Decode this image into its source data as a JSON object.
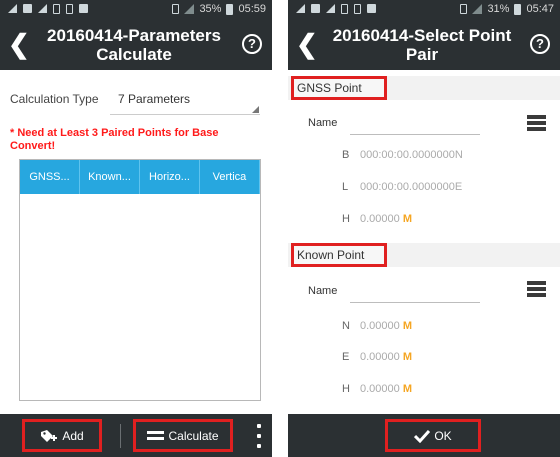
{
  "left": {
    "status": {
      "battery": "35%",
      "time": "05:59"
    },
    "title_line1": "20160414-Parameters",
    "title_line2": "Calculate",
    "help_label": "?",
    "calc_type_label": "Calculation Type",
    "calc_type_value": "7 Parameters",
    "warning": "* Need at Least 3 Paired Points for Base Convert!",
    "table_headers": [
      "GNSS...",
      "Known...",
      "Horizo...",
      "Vertica"
    ],
    "add_label": "Add",
    "calculate_label": "Calculate"
  },
  "right": {
    "status": {
      "battery": "31%",
      "time": "05:47"
    },
    "title_line1": "20160414-Select Point",
    "title_line2": "Pair",
    "help_label": "?",
    "gnss_section": "GNSS Point",
    "gnss_name_label": "Name",
    "gnss_coords": [
      {
        "label": "B",
        "value": "000:00:00.0000000N",
        "unit": ""
      },
      {
        "label": "L",
        "value": "000:00:00.0000000E",
        "unit": ""
      },
      {
        "label": "H",
        "value": "0.00000",
        "unit": "M"
      }
    ],
    "known_section": "Known Point",
    "known_name_label": "Name",
    "known_coords": [
      {
        "label": "N",
        "value": "0.00000",
        "unit": "M"
      },
      {
        "label": "E",
        "value": "0.00000",
        "unit": "M"
      },
      {
        "label": "H",
        "value": "0.00000",
        "unit": "M"
      }
    ],
    "ok_label": "OK"
  },
  "colors": {
    "accent_blue": "#27a7df",
    "bar_dark": "#2b3033",
    "highlight_red": "#e02020",
    "warning_red": "#ff1a1a",
    "unit_orange": "#f5a623"
  }
}
